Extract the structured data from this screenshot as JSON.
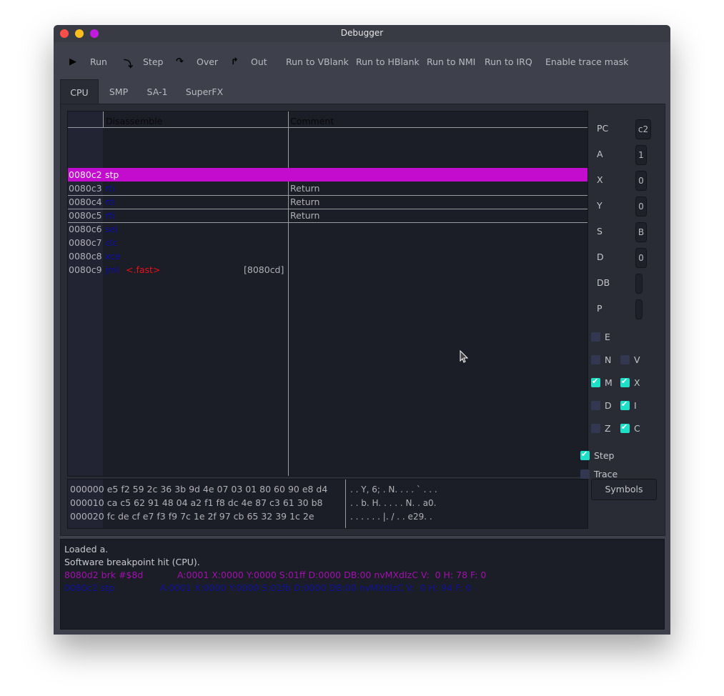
{
  "window": {
    "title": "Debugger"
  },
  "toolbar": {
    "run": "Run",
    "step": "Step",
    "over": "Over",
    "out": "Out",
    "run_vblank": "Run to VBlank",
    "run_hblank": "Run to HBlank",
    "run_nmi": "Run to NMI",
    "run_irq": "Run to IRQ",
    "trace_mask": "Enable trace mask"
  },
  "tabs": [
    "CPU",
    "SMP",
    "SA-1",
    "SuperFX"
  ],
  "active_tab": "CPU",
  "disassembly": {
    "headers": {
      "disassemble": "Disassemble",
      "comment": "Comment"
    },
    "rows": [
      {
        "addr": "0080c2",
        "op": "stp",
        "label": "",
        "target": "",
        "comment": "",
        "selected": true
      },
      {
        "addr": "0080c3",
        "op": "rti",
        "label": "",
        "target": "",
        "comment": "Return"
      },
      {
        "addr": "0080c4",
        "op": "rti",
        "label": "",
        "target": "",
        "comment": "Return"
      },
      {
        "addr": "0080c5",
        "op": "rti",
        "label": "",
        "target": "",
        "comment": "Return"
      },
      {
        "addr": "0080c6",
        "op": "sei",
        "label": "",
        "target": "",
        "comment": ""
      },
      {
        "addr": "0080c7",
        "op": "clc",
        "label": "",
        "target": "",
        "comment": ""
      },
      {
        "addr": "0080c8",
        "op": "xce",
        "label": "",
        "target": "",
        "comment": ""
      },
      {
        "addr": "0080c9",
        "op": "jml",
        "label": "<.fast>",
        "target": "[8080cd]",
        "comment": ""
      }
    ],
    "colors": {
      "selected_row": "#c40ccf",
      "opcode": "#0c0ca8",
      "label": "#e8121b"
    }
  },
  "registers": [
    {
      "name": "PC",
      "value": "c2"
    },
    {
      "name": "A",
      "value": "1"
    },
    {
      "name": "X",
      "value": "0"
    },
    {
      "name": "Y",
      "value": "0"
    },
    {
      "name": "S",
      "value": "B"
    },
    {
      "name": "D",
      "value": "0"
    },
    {
      "name": "DB",
      "value": ""
    },
    {
      "name": "P",
      "value": ""
    }
  ],
  "flags": {
    "E": false,
    "N": false,
    "V": false,
    "M": true,
    "X": true,
    "D": false,
    "I": true,
    "Z": false,
    "C": true
  },
  "options": {
    "step_label": "Step",
    "step": true,
    "trace_label": "Trace",
    "trace": false
  },
  "symbols_button": "Symbols",
  "hexdump": [
    {
      "addr": "000000",
      "bytes": "e5 f2 59 2c 36 3b 9d 4e 07 03 01 80 60 90 e8 d4",
      "ascii": ". . Y, 6; . N. . . . ` . . ."
    },
    {
      "addr": "000010",
      "bytes": "ca c5 62 91 48 04 a2 f1 f8 dc 4e 87 c3 61 30 b8",
      "ascii": ". . b. H. . . . . N. . a0."
    },
    {
      "addr": "000020",
      "bytes": "fc de cf e7 f3 f9 7c 1e 2f 97 cb 65 32 39 1c 2e",
      "ascii": ". . . . . . |. / . . e29. ."
    }
  ],
  "log": [
    {
      "type": "info",
      "text": "Loaded a."
    },
    {
      "type": "info",
      "text": "Software breakpoint hit (CPU)."
    },
    {
      "type": "prev",
      "text": "8080d2 brk #$8d            A:0001 X:0000 Y:0000 S:01ff D:0000 DB:00 nvMXdIzC V:  0 H: 78 F: 0"
    },
    {
      "type": "cur",
      "text": "0080c2 stp                A:0001 X:0000 Y:0000 S:01fb D:0000 DB:00 nvMXdIzC V:  0 H: 94 F: 0"
    }
  ]
}
